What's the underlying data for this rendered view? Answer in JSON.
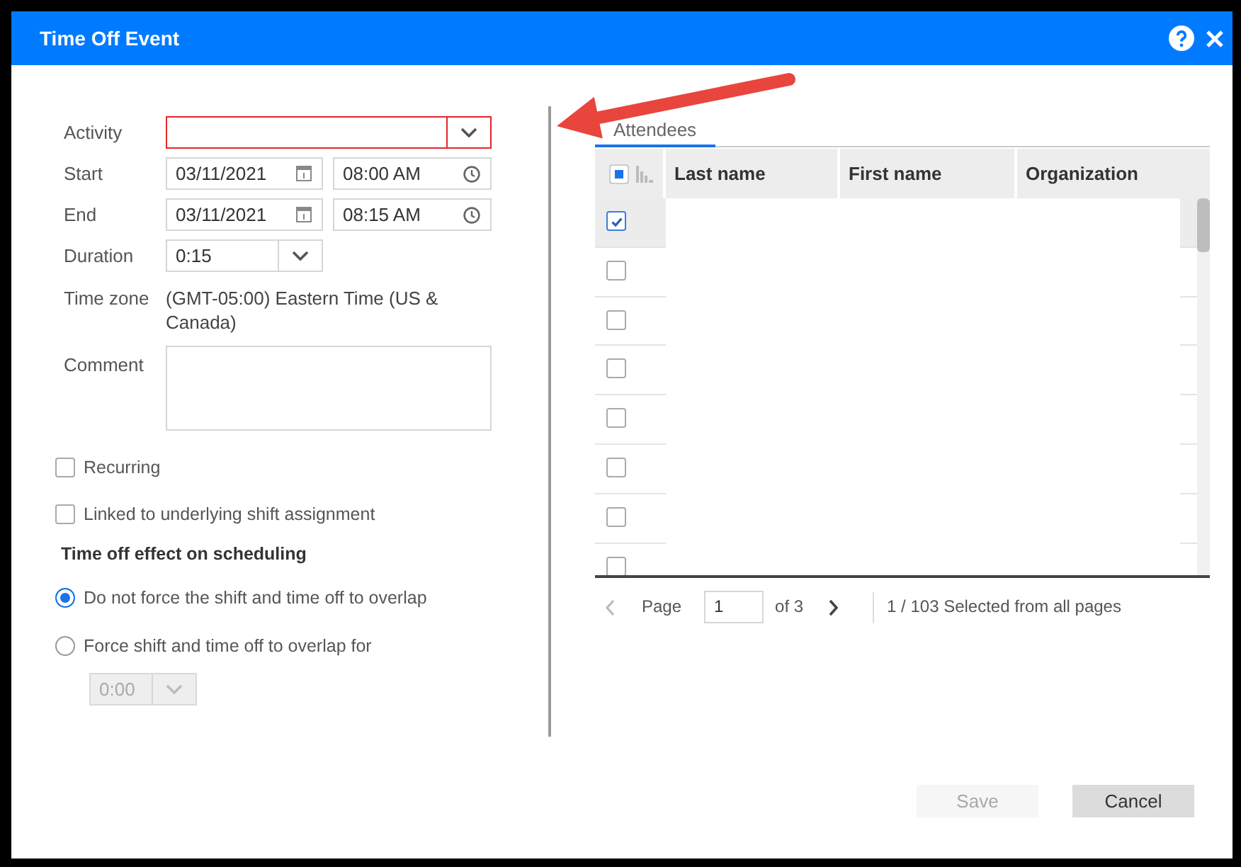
{
  "window": {
    "title": "Time Off Event"
  },
  "form": {
    "fields": [
      {
        "kind": "dropdown",
        "label": "Activity",
        "invalid": true
      },
      {
        "kind": "datetime",
        "label": "Start",
        "date": "03/11/2021",
        "time": "08:00 AM"
      },
      {
        "kind": "datetime",
        "label": "End",
        "date": "03/11/2021",
        "time": "08:15 AM"
      },
      {
        "kind": "short_dropdown",
        "label": "Duration",
        "value": "0:15",
        "invalid": false
      },
      {
        "kind": "text",
        "label": "Time zone",
        "value": "(GMT-05:00) Eastern Time (US & Canada)"
      },
      {
        "kind": "textarea",
        "label": "Comment"
      }
    ],
    "checkboxes": [
      {
        "label": "Recurring",
        "checked": false
      },
      {
        "label": "Linked to underlying shift assignment",
        "checked": false
      }
    ],
    "scheduling": {
      "heading": "Time off effect on scheduling",
      "options": [
        {
          "label": "Do not force the shift and time off to overlap",
          "selected": true
        },
        {
          "label": "Force shift and time off to overlap for",
          "selected": false
        }
      ],
      "overlap": {
        "value": "0:00",
        "disabled": true
      }
    }
  },
  "attendees": {
    "tabs": [
      {
        "label": "Attendees",
        "selected": true
      }
    ],
    "select_all": {
      "indeterminate": true
    },
    "columns": [
      "Last name",
      "First name",
      "Organization"
    ],
    "rows": [
      {
        "selected": true
      },
      {
        "selected": false
      },
      {
        "selected": false
      },
      {
        "selected": false
      },
      {
        "selected": false
      },
      {
        "selected": false
      },
      {
        "selected": false
      },
      {
        "selected": false
      }
    ],
    "pager": {
      "prev_disabled": true,
      "page_label": "Page",
      "page": "1",
      "of": "of 3",
      "next_disabled": false,
      "status": "1 / 103 Selected from all pages"
    }
  },
  "buttons": [
    {
      "label": "Save",
      "disabled": true
    },
    {
      "label": "Cancel",
      "disabled": false
    }
  ]
}
